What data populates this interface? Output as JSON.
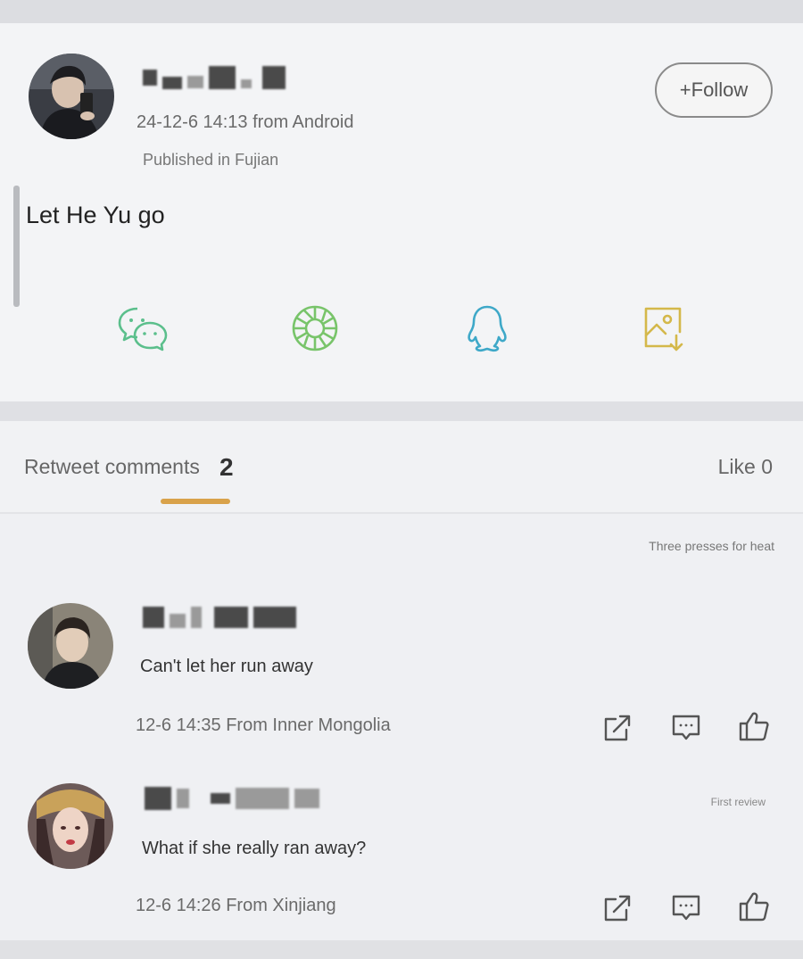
{
  "post": {
    "time_source": "24-12-6 14:13 from Android",
    "location": "Published in Fujian",
    "follow_label": "+Follow",
    "text": "Let He Yu go",
    "share_icons": [
      "wechat-icon",
      "moments-icon",
      "qq-icon",
      "save-image-icon"
    ]
  },
  "tabs": {
    "retweet_label": "Retweet comments",
    "retweet_count": "2",
    "like_label": "Like 0"
  },
  "comments_section": {
    "sort_label": "Three presses for heat",
    "comments": [
      {
        "text": "Can't let her run away",
        "meta": "12-6 14:35 From Inner Mongolia",
        "badge": ""
      },
      {
        "text": "What if she really ran away?",
        "meta": "12-6 14:26 From Xinjiang",
        "badge": "First review"
      }
    ]
  },
  "colors": {
    "wechat": "#5bbf8c",
    "moments": "#78c46a",
    "qq": "#3ea8c8",
    "save": "#d4b84a",
    "tab_underline": "#d9a24a"
  }
}
